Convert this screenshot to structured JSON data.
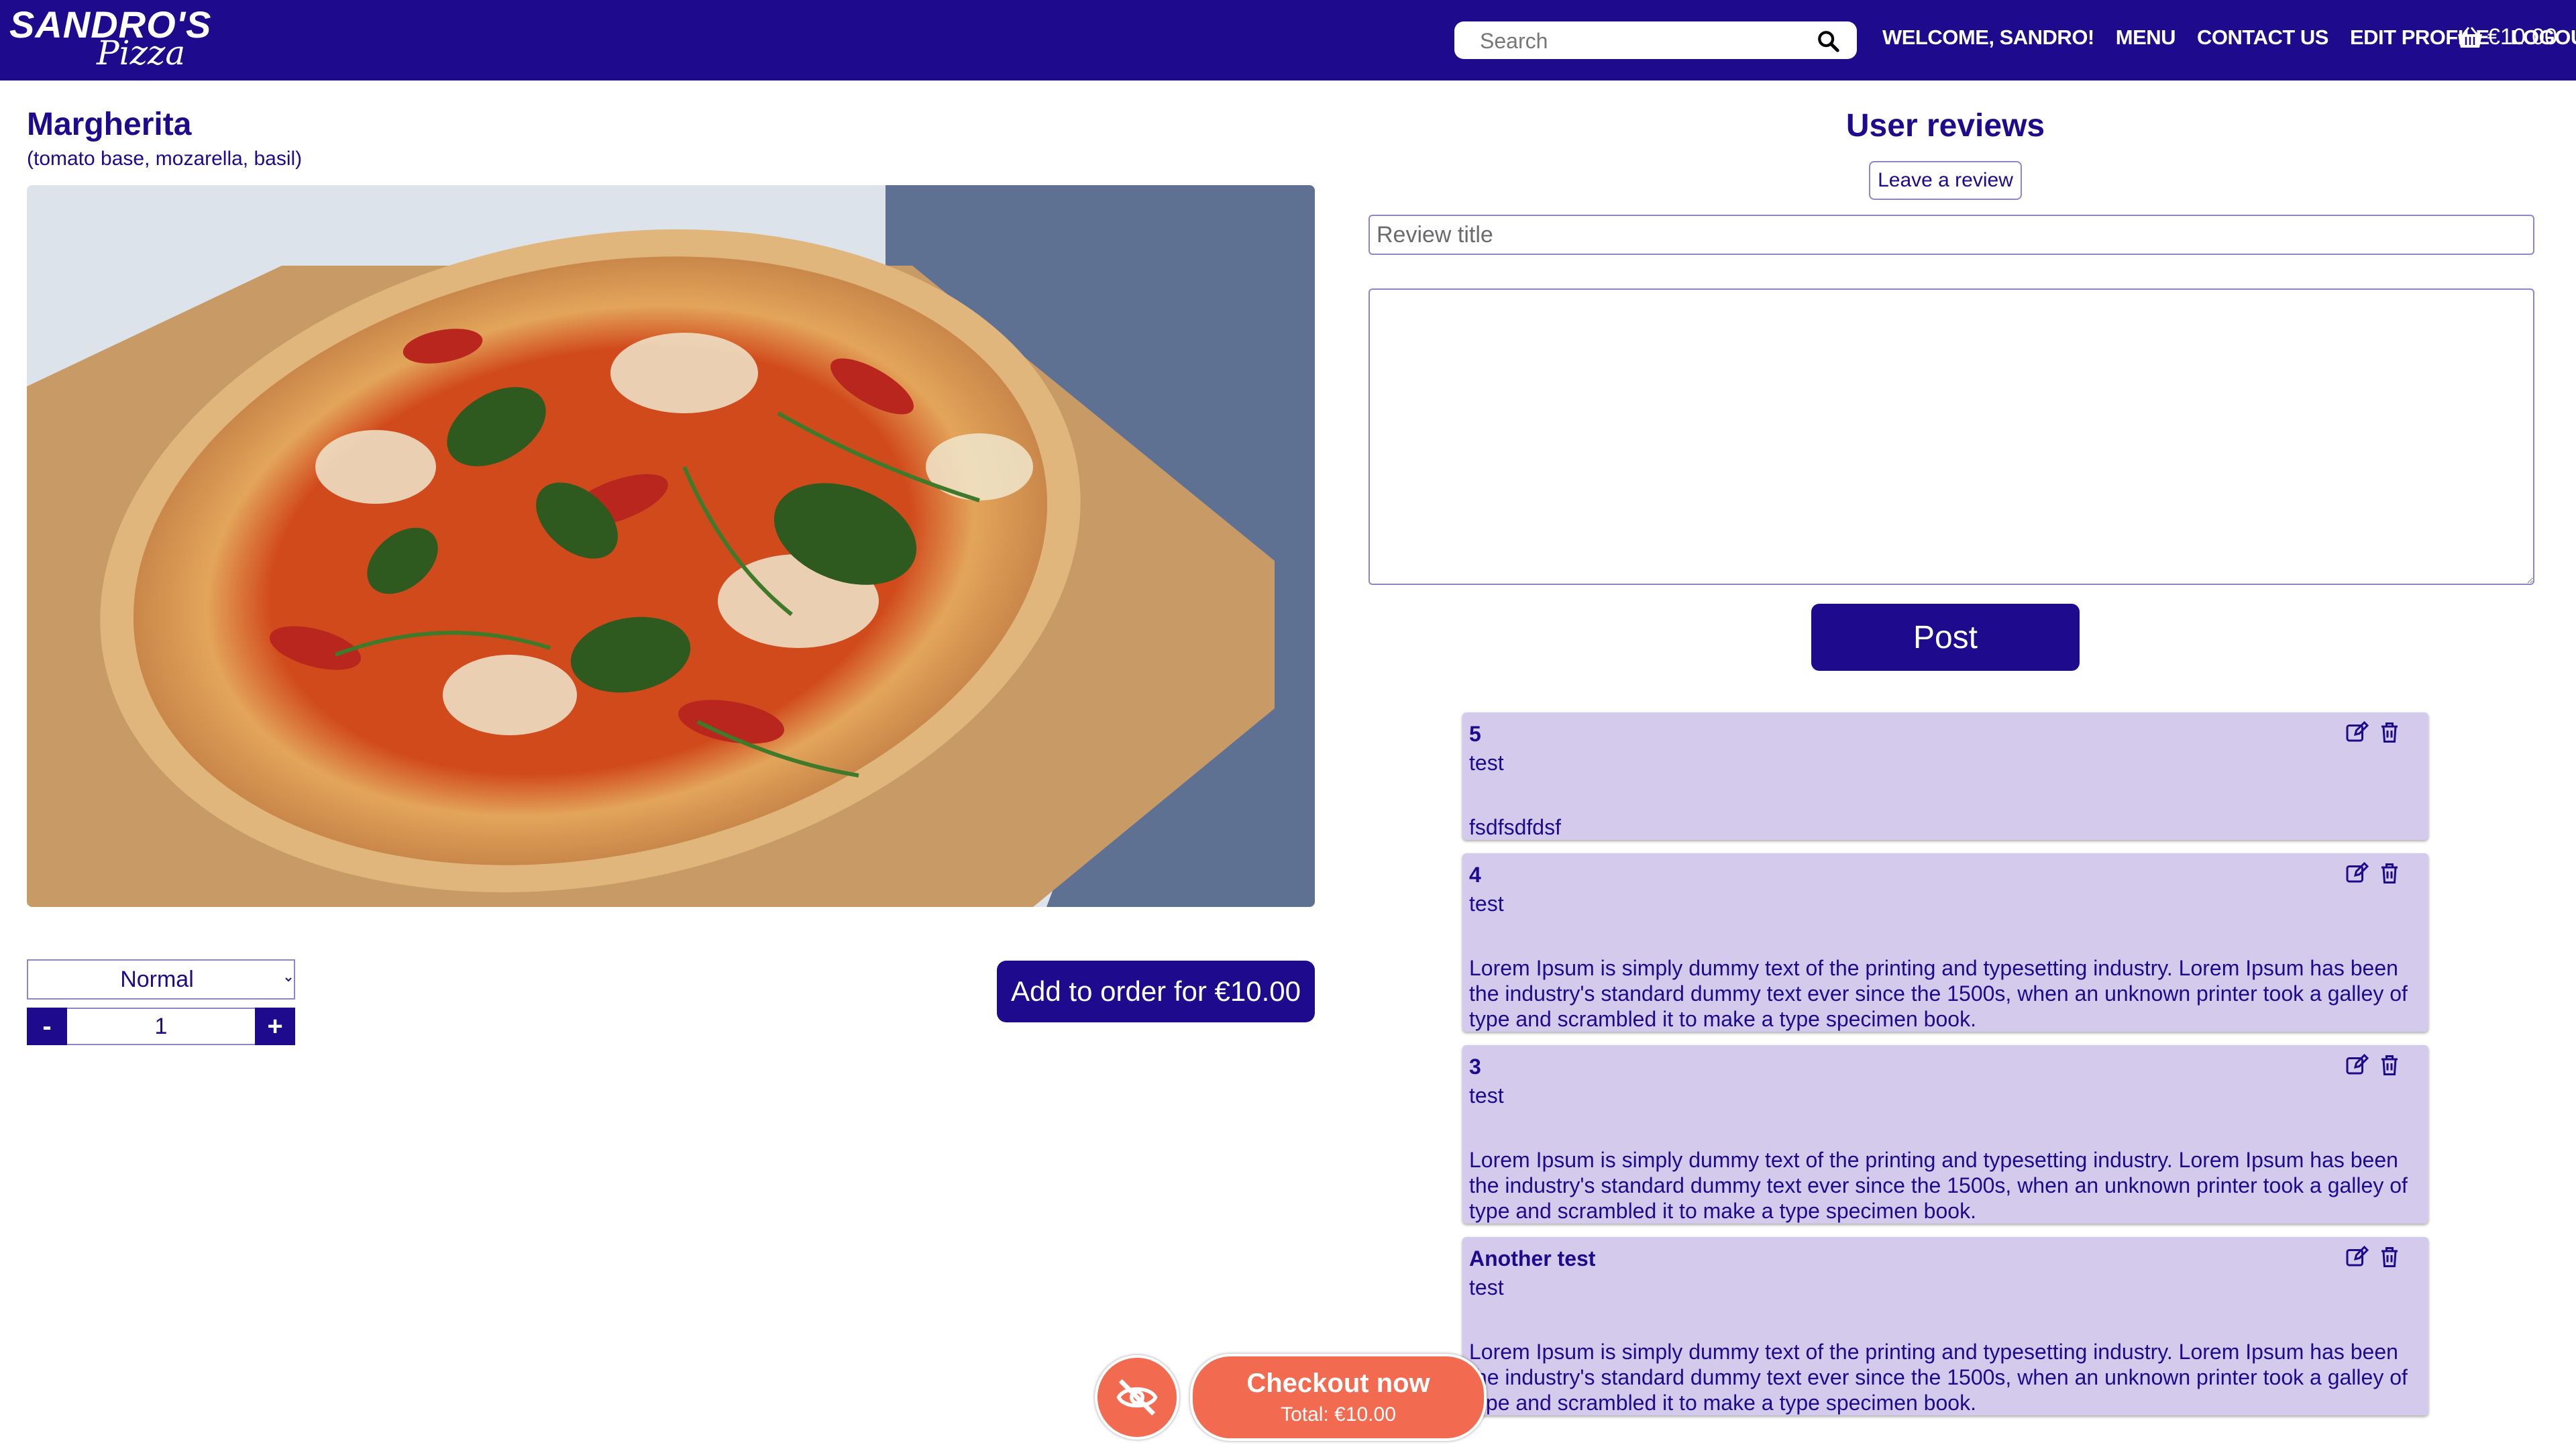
{
  "brand": {
    "logo_main": "SANDRO'S",
    "logo_sub": "Pizza"
  },
  "navbar": {
    "search_placeholder": "Search",
    "links": [
      "WELCOME, SANDRO!",
      "MENU",
      "CONTACT US",
      "EDIT PROFILE",
      "LOGOUT"
    ],
    "cart_total": "€10.00",
    "icons": {
      "search": "search-icon",
      "cart": "basket-icon"
    }
  },
  "product": {
    "name": "Margherita",
    "ingredients": "(tomato base, mozarella, basil)",
    "size_selected": "Normal",
    "quantity": "1",
    "minus_label": "-",
    "plus_label": "+",
    "add_to_order_label": "Add to order for €10.00"
  },
  "reviews": {
    "heading": "User reviews",
    "leave_review_label": "Leave a review",
    "title_placeholder": "Review title",
    "post_label": "Post",
    "items": [
      {
        "rating": "5",
        "subtitle": "test",
        "text": "fsdfsdfdsf"
      },
      {
        "rating": "4",
        "subtitle": "test",
        "text": "Lorem Ipsum is simply dummy text of the printing and typesetting industry. Lorem Ipsum has been the industry's standard dummy text ever since the 1500s, when an unknown printer took a galley of type and scrambled it to make a type specimen book."
      },
      {
        "rating": "3",
        "subtitle": "test",
        "text": "Lorem Ipsum is simply dummy text of the printing and typesetting industry. Lorem Ipsum has been the industry's standard dummy text ever since the 1500s, when an unknown printer took a galley of type and scrambled it to make a type specimen book."
      },
      {
        "rating": "Another test",
        "subtitle": "test",
        "text": "Lorem Ipsum is simply dummy text of the printing and typesetting industry. Lorem Ipsum has been the industry's standard dummy text ever since the 1500s, when an unknown printer took a galley of type and scrambled it to make a type specimen book."
      }
    ],
    "icons": {
      "edit": "edit-icon",
      "delete": "trash-icon"
    }
  },
  "checkout": {
    "title": "Checkout now",
    "total": "Total: €10.00",
    "hide_icon": "eye-slash-icon"
  },
  "colors": {
    "primary": "#1e0a8c",
    "review_card": "#d4cbec",
    "checkout": "#f26a4f"
  }
}
